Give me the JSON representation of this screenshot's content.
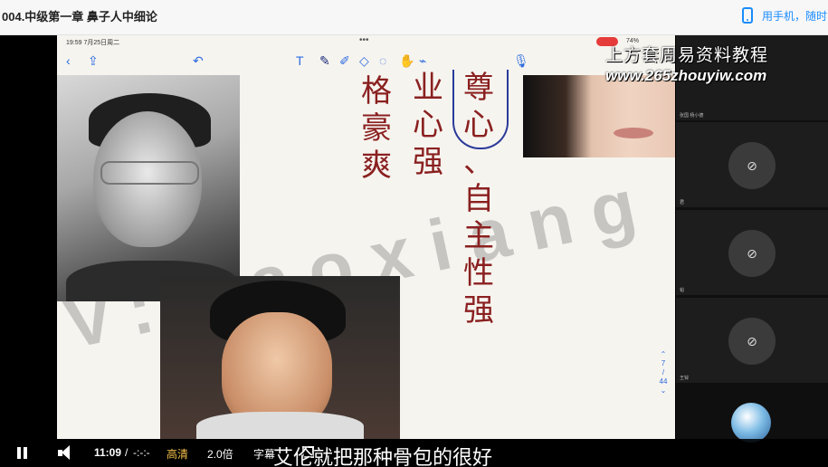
{
  "header": {
    "title": "004.中级第一章 鼻子人中细论",
    "phone_link": "用手机，随时"
  },
  "ipad": {
    "status_time": "19:59  7月25日周二",
    "battery": "74%",
    "dots": "•••"
  },
  "slide": {
    "col1": [
      "格",
      "豪",
      "爽"
    ],
    "col2": [
      "业",
      "心",
      "强"
    ],
    "col3": [
      "尊",
      "心",
      "、",
      "自",
      "主",
      "性",
      "强"
    ],
    "watermark": "V:liaoxiang",
    "page_current": "7",
    "page_total": "44"
  },
  "overlay": {
    "site_name_cn": "上方套周易资料教程",
    "site_url": "www.265zhouyiw.com"
  },
  "participants": [
    {
      "name": "张国 杨小德"
    },
    {
      "name": "君"
    },
    {
      "name": "韬"
    },
    {
      "name": "王锌"
    }
  ],
  "player": {
    "time_current": "11:09",
    "time_separator": "/",
    "time_total": "-:-:-",
    "quality": "高清",
    "speed": "2.0倍",
    "subtitle_btn": "字幕",
    "subtitle_text": "艾伦就把那种骨包的很好"
  },
  "colors": {
    "accent": "#1a8cff",
    "quality": "#f5c04a",
    "calligraphy": "#8a2020"
  }
}
